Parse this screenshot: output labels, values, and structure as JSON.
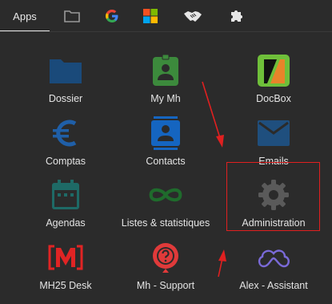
{
  "tabs": [
    {
      "label": "Apps",
      "icon": "apps"
    },
    {
      "label": "",
      "icon": "folder-icon"
    },
    {
      "label": "",
      "icon": "google-icon"
    },
    {
      "label": "",
      "icon": "microsoft-icon"
    },
    {
      "label": "",
      "icon": "handshake-icon"
    },
    {
      "label": "",
      "icon": "puzzle-icon"
    }
  ],
  "apps": [
    {
      "label": "Dossier",
      "icon": "folder-icon",
      "color": "#1a4a7a"
    },
    {
      "label": "My Mh",
      "icon": "badge-icon",
      "color": "#3c8a3c"
    },
    {
      "label": "DocBox",
      "icon": "docbox-icon",
      "color": "#6fbf3a"
    },
    {
      "label": "Comptas",
      "icon": "euro-icon",
      "color": "#1f5fa8"
    },
    {
      "label": "Contacts",
      "icon": "contact-card-icon",
      "color": "#1565c0"
    },
    {
      "label": "Emails",
      "icon": "envelope-icon",
      "color": "#1f4f7e"
    },
    {
      "label": "Agendas",
      "icon": "calendar-icon",
      "color": "#1e6a66"
    },
    {
      "label": "Listes & statistiques",
      "icon": "infinity-icon",
      "color": "#1f6b2c"
    },
    {
      "label": "Administration",
      "icon": "gear-icon",
      "color": "#5a5a5a"
    },
    {
      "label": "MH25 Desk",
      "icon": "mh25-icon",
      "color": "#e02424"
    },
    {
      "label": "Mh - Support",
      "icon": "support-icon",
      "color": "#e03a3a"
    },
    {
      "label": "Alex - Assistant",
      "icon": "cloud-loop-icon",
      "color": "#7a6ad8"
    }
  ],
  "colors": {
    "background": "#2b2b2b",
    "annotation": "#e02020"
  }
}
